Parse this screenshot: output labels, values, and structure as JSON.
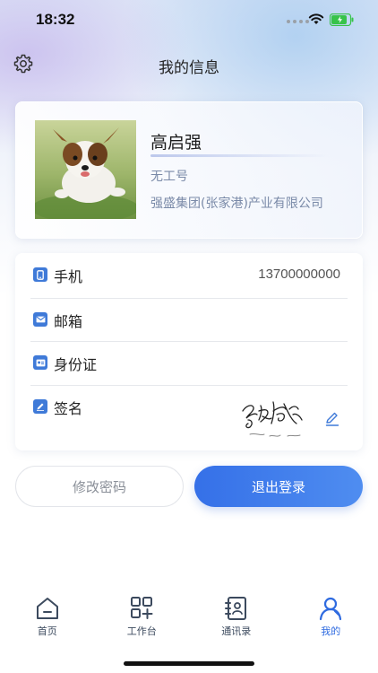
{
  "status_bar": {
    "time": "18:32",
    "battery_level": 0.85,
    "battery_color": "#37c34a"
  },
  "header": {
    "title": "我的信息",
    "settings_icon": "gear-icon"
  },
  "profile": {
    "name": "高启强",
    "employee_no": "无工号",
    "company": "强盛集团(张家港)产业有限公司",
    "avatar": "dog-photo"
  },
  "info_rows": [
    {
      "icon": "phone-icon",
      "label": "手机",
      "value": "13700000000"
    },
    {
      "icon": "mail-icon",
      "label": "邮箱",
      "value": ""
    },
    {
      "icon": "id-card-icon",
      "label": "身份证",
      "value": ""
    },
    {
      "icon": "signature-icon",
      "label": "签名",
      "value": ""
    }
  ],
  "buttons": {
    "change_password": "修改密码",
    "logout": "退出登录"
  },
  "tabs": [
    {
      "label": "首页",
      "icon": "home-icon",
      "active": false
    },
    {
      "label": "工作台",
      "icon": "workbench-icon",
      "active": false
    },
    {
      "label": "通讯录",
      "icon": "contacts-icon",
      "active": false
    },
    {
      "label": "我的",
      "icon": "user-icon",
      "active": true
    }
  ],
  "colors": {
    "accent": "#2f6be0",
    "icon_blue": "#3f7ad8",
    "secondary_text": "#7a8aa8"
  }
}
